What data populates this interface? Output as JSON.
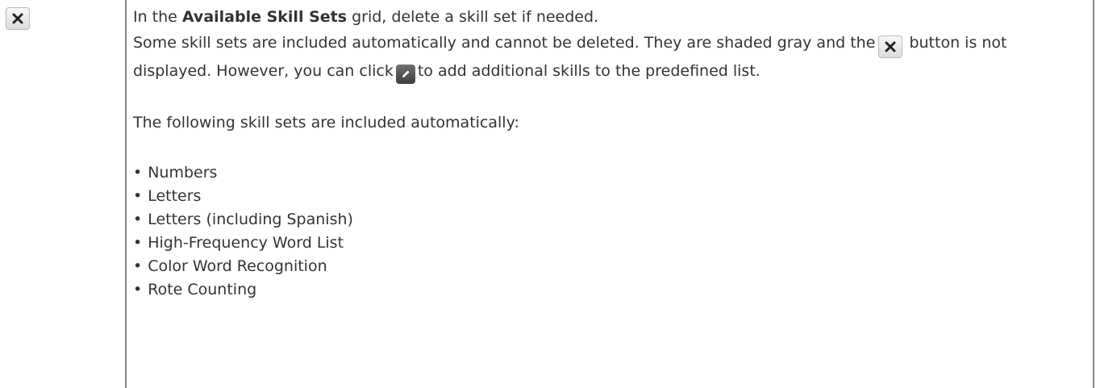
{
  "row": {
    "icon_name": "close-icon",
    "intro": {
      "prefix": "In the ",
      "bold": "Available Skill Sets",
      "suffix": " grid, delete a skill set if needed."
    },
    "note": {
      "part1": "Some skill sets are included automatically and cannot be deleted. They are shaded gray and the",
      "part2": "button is not displayed. However, you can click",
      "part3": "to add additional skills to the predefined list.",
      "delete_icon": "close-icon",
      "edit_icon": "pencil-edit-icon"
    },
    "list_intro": "The following skill sets are included automatically:",
    "skill_sets": [
      "Numbers",
      "Letters",
      "Letters (including Spanish)",
      "High-Frequency Word List",
      "Color Word Recognition",
      "Rote Counting"
    ]
  },
  "colors": {
    "text": "#333333",
    "border": "#888888",
    "button_face": "#e8e8e8"
  }
}
